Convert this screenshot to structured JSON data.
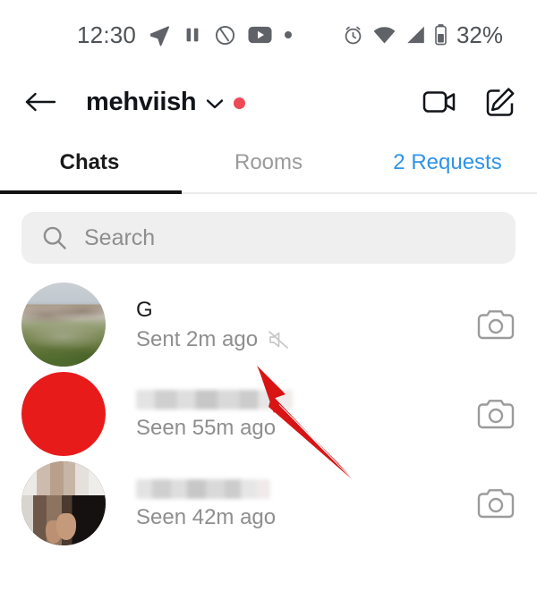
{
  "status_bar": {
    "time": "12:30",
    "battery_percent": "32%",
    "left_icons": [
      "telegram-send-icon",
      "pause-icon",
      "circle-slash-icon",
      "youtube-icon",
      "dot-icon"
    ],
    "right_icons": [
      "alarm-clock-icon",
      "wifi-icon",
      "cellular-signal-icon",
      "battery-icon"
    ]
  },
  "header": {
    "back_icon": "arrow-left-icon",
    "account_name": "mehviish",
    "chevron_icon": "chevron-down-icon",
    "unread_dot_color": "#ED4956",
    "video_call_icon": "video-camera-icon",
    "new_message_icon": "compose-pencil-icon"
  },
  "tabs": [
    {
      "label": "Chats",
      "state": "active"
    },
    {
      "label": "Rooms",
      "state": "inactive"
    },
    {
      "label": "2 Requests",
      "state": "link"
    }
  ],
  "search": {
    "icon": "search-icon",
    "placeholder": "Search",
    "value": ""
  },
  "chats": [
    {
      "avatar_type": "landscape-photo",
      "name": "G",
      "name_censored": false,
      "status": "Sent 2m ago",
      "muted_icon": "speaker-muted-icon",
      "action_icon": "camera-icon"
    },
    {
      "avatar_type": "solid-red",
      "name": "",
      "name_censored": true,
      "status": "Seen 55m ago",
      "muted_icon": null,
      "action_icon": "camera-icon"
    },
    {
      "avatar_type": "person-photo",
      "name": "",
      "name_censored": true,
      "status": "Seen 42m ago",
      "muted_icon": null,
      "action_icon": "camera-icon"
    }
  ],
  "annotation": {
    "type": "arrow",
    "color": "#D81414",
    "points_to": "speaker-muted-icon"
  },
  "colors": {
    "accent_blue": "#2F93E8",
    "red": "#ED4956",
    "text_primary": "#1A1A1A",
    "text_secondary": "#8E8E8E",
    "search_bg": "#EFEFEF"
  }
}
